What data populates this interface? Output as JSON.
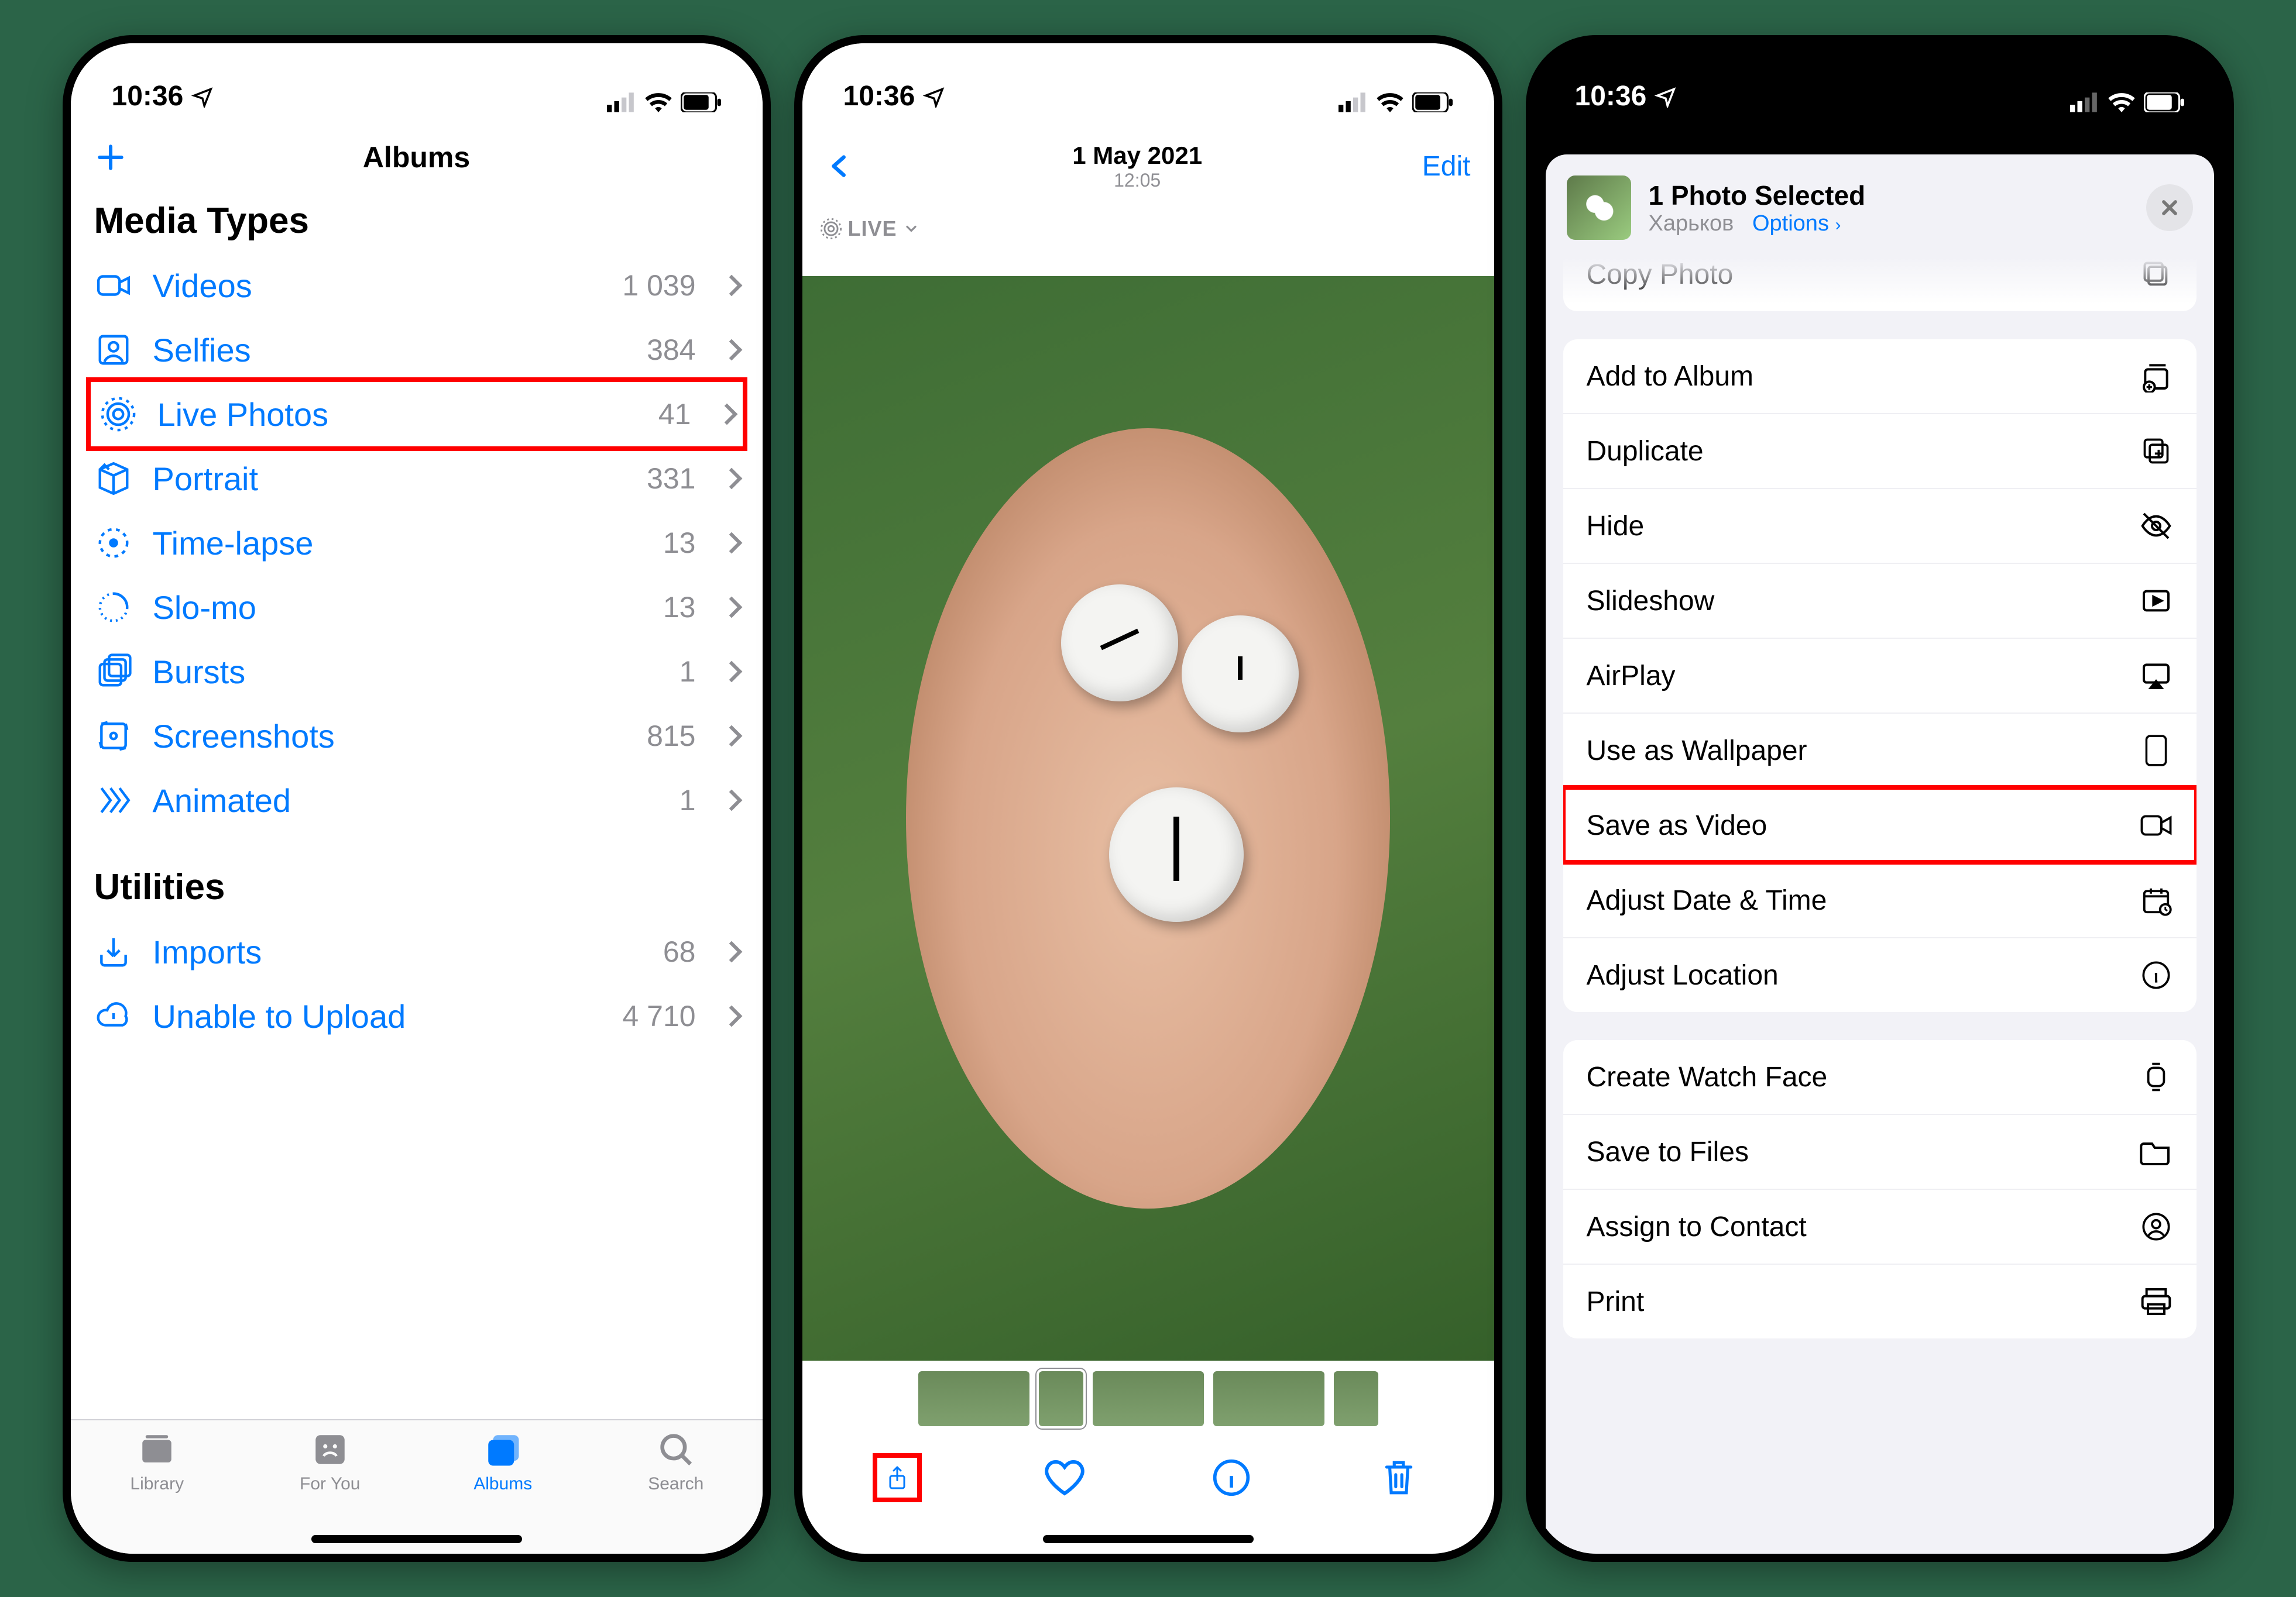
{
  "status_time": "10:36",
  "screen1": {
    "nav_title": "Albums",
    "section_media": "Media Types",
    "section_utilities": "Utilities",
    "items": [
      {
        "label": "Videos",
        "count": "1 039"
      },
      {
        "label": "Selfies",
        "count": "384"
      },
      {
        "label": "Live Photos",
        "count": "41"
      },
      {
        "label": "Portrait",
        "count": "331"
      },
      {
        "label": "Time-lapse",
        "count": "13"
      },
      {
        "label": "Slo-mo",
        "count": "13"
      },
      {
        "label": "Bursts",
        "count": "1"
      },
      {
        "label": "Screenshots",
        "count": "815"
      },
      {
        "label": "Animated",
        "count": "1"
      }
    ],
    "utilities": [
      {
        "label": "Imports",
        "count": "68"
      },
      {
        "label": "Unable to Upload",
        "count": "4 710"
      }
    ],
    "tabs": {
      "library": "Library",
      "for_you": "For You",
      "albums": "Albums",
      "search": "Search"
    }
  },
  "screen2": {
    "date": "1 May 2021",
    "time": "12:05",
    "edit": "Edit",
    "live": "LIVE"
  },
  "screen3": {
    "title": "1 Photo Selected",
    "subtitle": "Харьков",
    "options": "Options",
    "actions_top_partial": "Copy Photo",
    "group_a": [
      "Add to Album",
      "Duplicate",
      "Hide",
      "Slideshow",
      "AirPlay",
      "Use as Wallpaper",
      "Save as Video",
      "Adjust Date & Time",
      "Adjust Location"
    ],
    "group_b": [
      "Create Watch Face",
      "Save to Files",
      "Assign to Contact",
      "Print"
    ]
  }
}
